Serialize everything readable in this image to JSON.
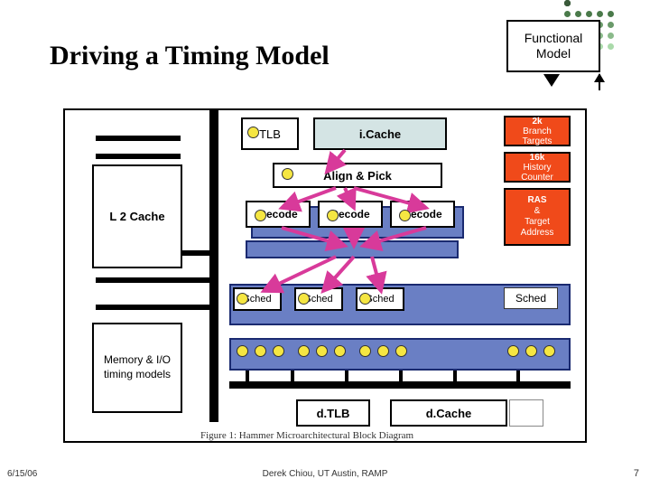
{
  "title": "Driving a Timing Model",
  "functional_model": "Functional\nModel",
  "blocks": {
    "l2": "L 2 Cache",
    "mem": "Memory & I/O timing models",
    "tlb": "TLB",
    "icache": "i.Cache",
    "align": "Align & Pick",
    "decode": "Decode",
    "sched": "Sched",
    "dtlb": "d.TLB",
    "dcache": "d.Cache"
  },
  "predictors": {
    "p1a": "2k",
    "p1b": "Branch",
    "p1c": "Targets",
    "p2a": "16k",
    "p2b": "History",
    "p2c": "Counter",
    "p3a": "RAS",
    "p3b": "&",
    "p3c": "Target Address"
  },
  "caption": "Figure 1: Hammer Microarchitectural Block Diagram",
  "footer": {
    "date": "6/15/06",
    "center": "Derek Chiou, UT Austin, RAMP",
    "page": "7"
  }
}
